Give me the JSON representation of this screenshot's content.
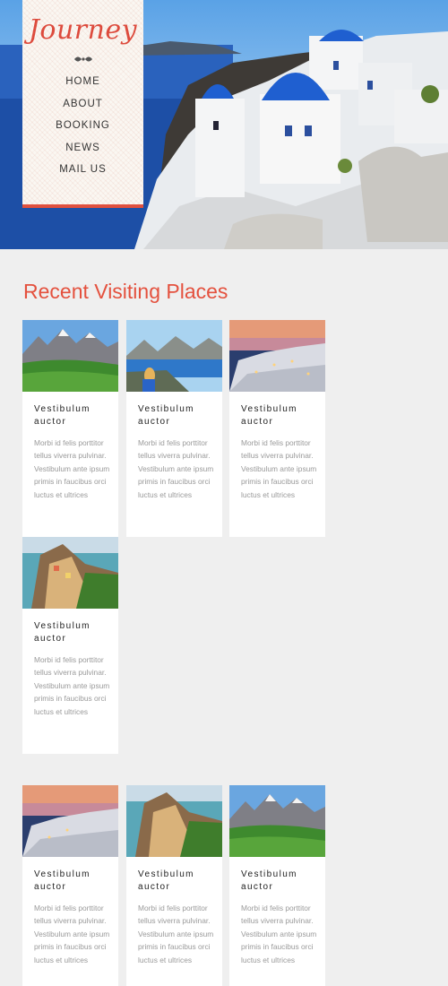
{
  "header": {
    "logo": "Journey",
    "nav": [
      "HOME",
      "ABOUT",
      "BOOKING",
      "NEWS",
      "MAIL US"
    ]
  },
  "section": {
    "title": "Recent Visiting Places"
  },
  "cards": [
    {
      "title": "Vestibulum auctor",
      "text": "Morbi id felis porttitor tellus viverra pulvinar. Vestibulum ante ipsum primis in faucibus orci luctus et ultrices",
      "image": "mountain-meadow"
    },
    {
      "title": "Vestibulum auctor",
      "text": "Morbi id felis porttitor tellus viverra pulvinar. Vestibulum ante ipsum primis in faucibus orci luctus et ultrices",
      "image": "fjord-lookout"
    },
    {
      "title": "Vestibulum auctor",
      "text": "Morbi id felis porttitor tellus viverra pulvinar. Vestibulum ante ipsum primis in faucibus orci luctus et ultrices",
      "image": "santorini-dusk"
    },
    {
      "title": "Vestibulum auctor",
      "text": "Morbi id felis porttitor tellus viverra pulvinar. Vestibulum ante ipsum primis in faucibus orci luctus et ultrices",
      "image": "cliff-village"
    },
    {
      "title": "Vestibulum auctor",
      "text": "Morbi id felis porttitor tellus viverra pulvinar. Vestibulum ante ipsum primis in faucibus orci luctus et ultrices",
      "image": "santorini-dusk"
    },
    {
      "title": "Vestibulum auctor",
      "text": "Morbi id felis porttitor tellus viverra pulvinar. Vestibulum ante ipsum primis in faucibus orci luctus et ultrices",
      "image": "cliff-village"
    },
    {
      "title": "Vestibulum auctor",
      "text": "Morbi id felis porttitor tellus viverra pulvinar. Vestibulum ante ipsum primis in faucibus orci luctus et ultrices",
      "image": "mountain-meadow"
    }
  ],
  "colors": {
    "accent": "#e4513e",
    "page_bg": "#efefef",
    "dome_blue": "#1f5fd0"
  }
}
